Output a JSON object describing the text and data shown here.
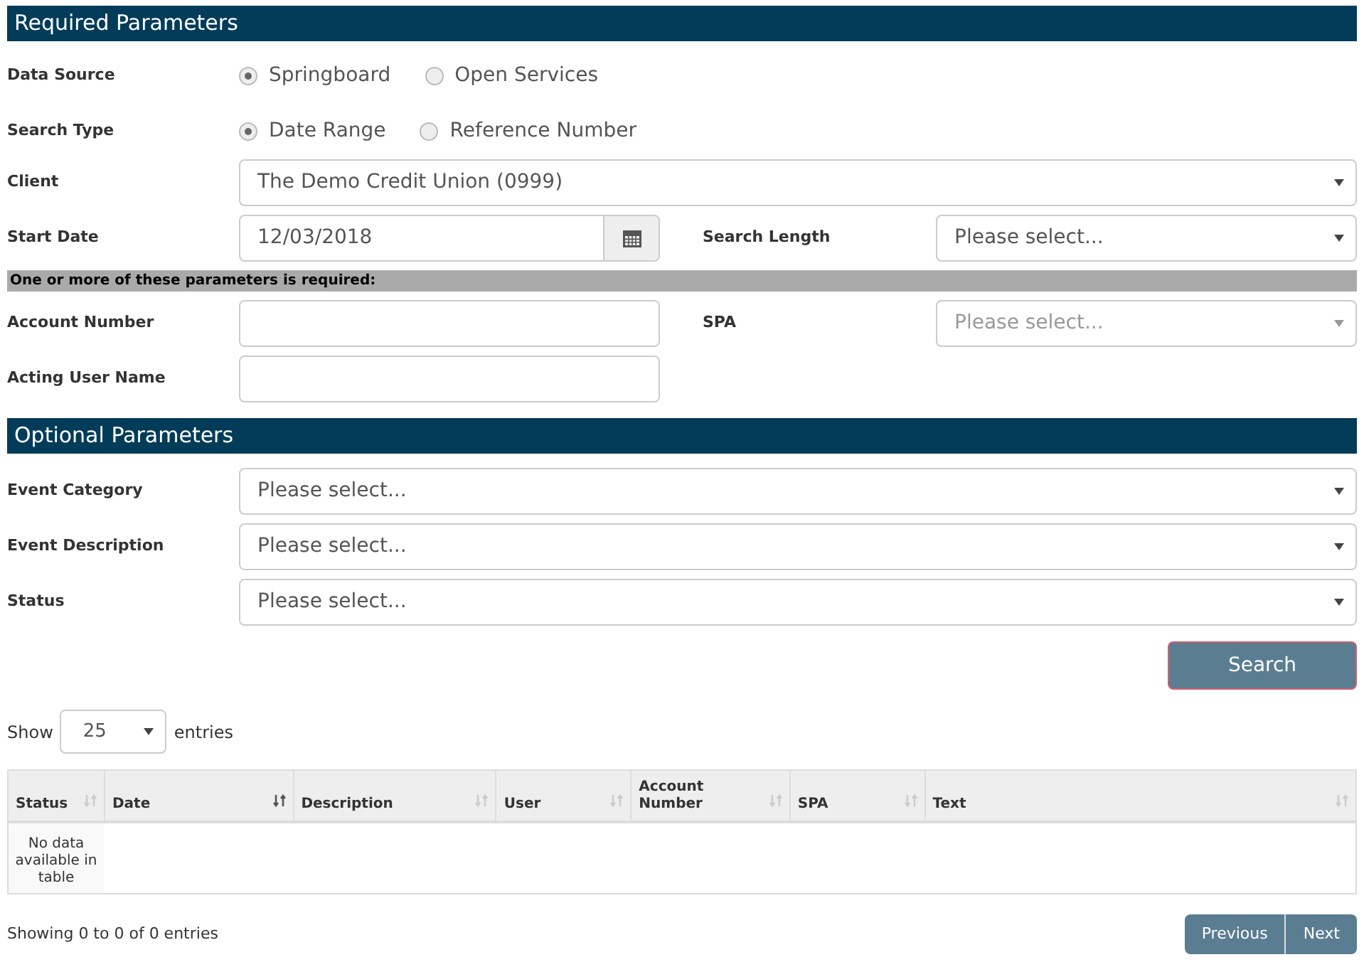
{
  "required_section": {
    "title": "Required Parameters"
  },
  "data_source": {
    "label": "Data Source",
    "options": [
      {
        "label": "Springboard",
        "selected": true
      },
      {
        "label": "Open Services",
        "selected": false
      }
    ]
  },
  "search_type": {
    "label": "Search Type",
    "options": [
      {
        "label": "Date Range",
        "selected": true
      },
      {
        "label": "Reference Number",
        "selected": false
      }
    ]
  },
  "client": {
    "label": "Client",
    "value": "The Demo Credit Union (0999)"
  },
  "start_date": {
    "label": "Start Date",
    "value": "12/03/2018"
  },
  "search_length": {
    "label": "Search Length",
    "value": "Please select...",
    "disabled": false
  },
  "notice": "One or more of these parameters is required:",
  "account_number": {
    "label": "Account Number"
  },
  "spa": {
    "label": "SPA",
    "value": "Please select...",
    "disabled": true
  },
  "acting_user_name": {
    "label": "Acting User Name"
  },
  "optional_section": {
    "title": "Optional Parameters"
  },
  "optional_fields": [
    {
      "label": "Event Category",
      "value": "Please select..."
    },
    {
      "label": "Event Description",
      "value": "Please select..."
    },
    {
      "label": "Status",
      "value": "Please select..."
    }
  ],
  "search_button": "Search",
  "length_menu": {
    "before": "Show",
    "value": "25",
    "after": "entries"
  },
  "table": {
    "columns": [
      {
        "label": "Status",
        "sorted": false
      },
      {
        "label": "Date",
        "sorted": true
      },
      {
        "label": "Description",
        "sorted": false
      },
      {
        "label": "User",
        "sorted": false
      },
      {
        "label": "Account Number",
        "sorted": false
      },
      {
        "label": "SPA",
        "sorted": false
      },
      {
        "label": "Text",
        "sorted": false
      }
    ],
    "empty_message": "No data available in table"
  },
  "info": "Showing 0 to 0 of 0 entries",
  "pagination": [
    "Previous",
    "Next"
  ]
}
